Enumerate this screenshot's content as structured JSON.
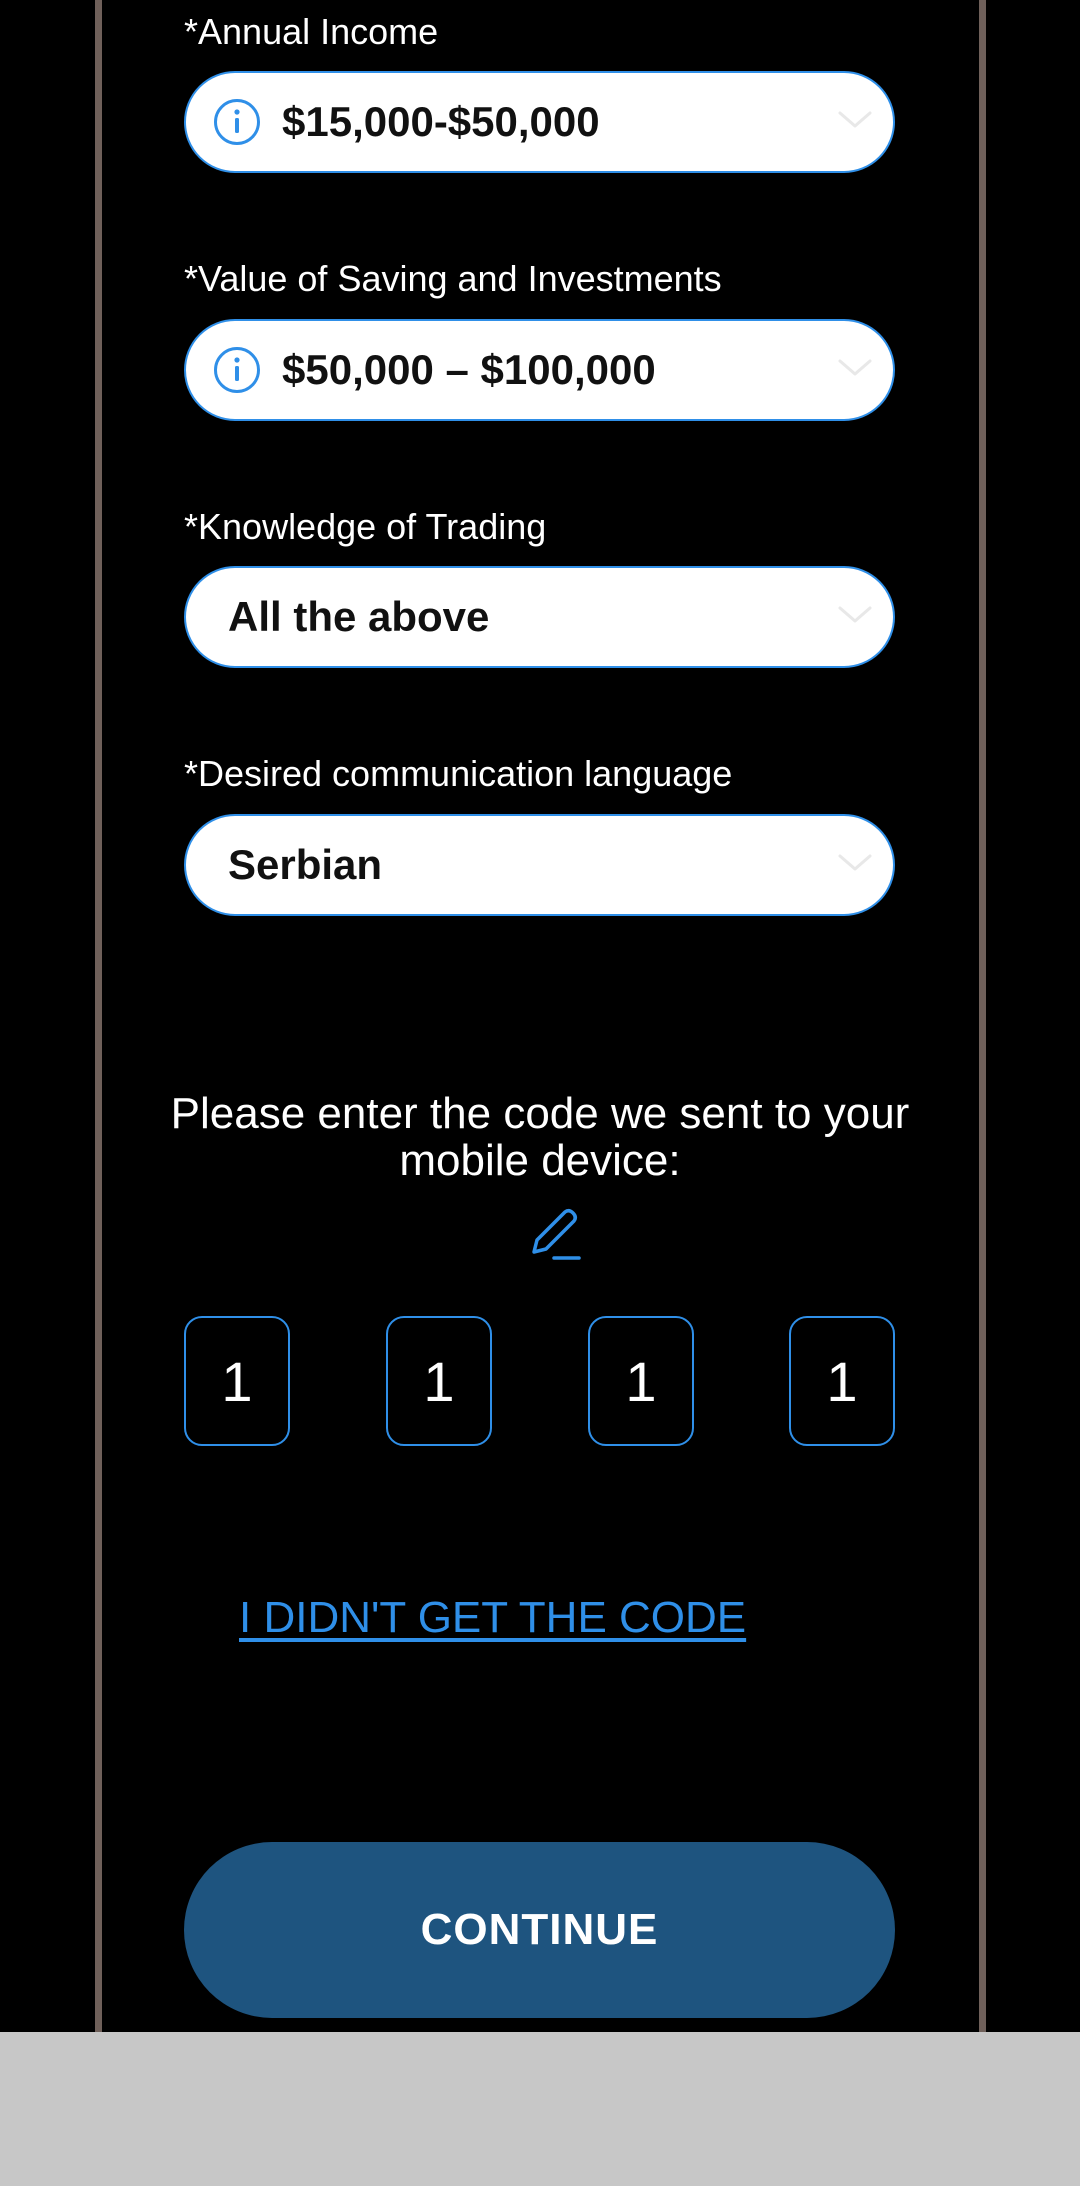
{
  "form": {
    "annual_income": {
      "label": "*Annual Income",
      "value": "$15,000-$50,000",
      "icon": "info-icon"
    },
    "savings_value": {
      "label": "*Value of Saving and Investments",
      "value": "$50,000 – $100,000",
      "icon": "info-icon"
    },
    "trading_knowledge": {
      "label": "*Knowledge of Trading",
      "value": "All the above"
    },
    "communication_language": {
      "label": "*Desired communication language",
      "value": "Serbian"
    }
  },
  "verification": {
    "prompt": "Please enter the code we sent to your mobile device:",
    "edit_icon": "pencil-icon",
    "code_digits": [
      "1",
      "1",
      "1",
      "1"
    ],
    "resend_link": "I DIDN'T GET THE CODE"
  },
  "actions": {
    "continue_label": "CONTINUE"
  },
  "colors": {
    "background": "#000000",
    "accent": "#2f8fe8",
    "button": "#1e547f",
    "frame": "#6f605a",
    "bottom_bar": "#c7c7c7"
  }
}
